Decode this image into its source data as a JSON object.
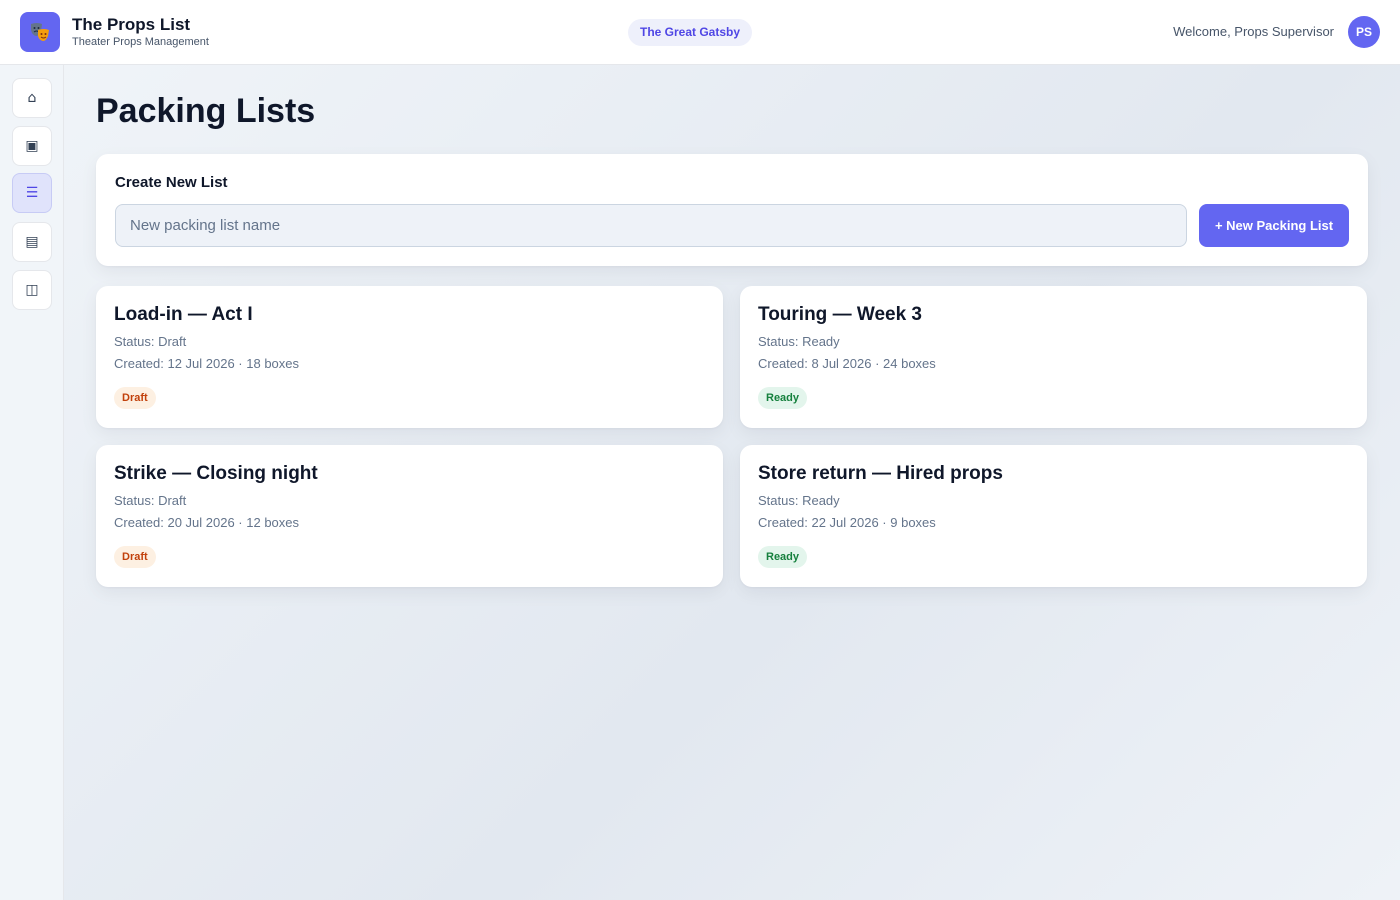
{
  "header": {
    "app_title": "The Props List",
    "app_subtitle": "Theater Props Management",
    "production": "The Great Gatsby",
    "welcome": "Welcome, Props Supervisor",
    "avatar_initials": "PS",
    "logo_icon": "theater-masks-icon"
  },
  "sidebar": {
    "items": [
      {
        "icon": "home-icon",
        "glyph": "⌂",
        "active": false
      },
      {
        "icon": "props-icon",
        "glyph": "▣",
        "active": false
      },
      {
        "icon": "list-icon",
        "glyph": "☰",
        "active": true
      },
      {
        "icon": "inventory-icon",
        "glyph": "▤",
        "active": false
      },
      {
        "icon": "layout-icon",
        "glyph": "◫",
        "active": false
      }
    ]
  },
  "main": {
    "page_title": "Packing Lists",
    "create": {
      "heading": "Create New List",
      "input_placeholder": "New packing list name",
      "input_value": "",
      "button_label": "+ New Packing List"
    },
    "lists": [
      {
        "title": "Load-in — Act I",
        "status": "Status: Draft",
        "meta": "Created: 12 Jul 2026 · 18 boxes",
        "badge": "Draft",
        "badge_kind": "draft"
      },
      {
        "title": "Touring — Week 3",
        "status": "Status: Ready",
        "meta": "Created: 8 Jul 2026 · 24 boxes",
        "badge": "Ready",
        "badge_kind": "ready"
      },
      {
        "title": "Strike — Closing night",
        "status": "Status: Draft",
        "meta": "Created: 20 Jul 2026 · 12 boxes",
        "badge": "Draft",
        "badge_kind": "draft"
      },
      {
        "title": "Store return — Hired props",
        "status": "Status: Ready",
        "meta": "Created: 22 Jul 2026 · 9 boxes",
        "badge": "Ready",
        "badge_kind": "ready"
      }
    ]
  },
  "colors": {
    "accent": "#6366f1",
    "draft_text": "#c2410c",
    "draft_bg": "#fdf0e2",
    "ready_text": "#15803d",
    "ready_bg": "#e3f5ec"
  }
}
